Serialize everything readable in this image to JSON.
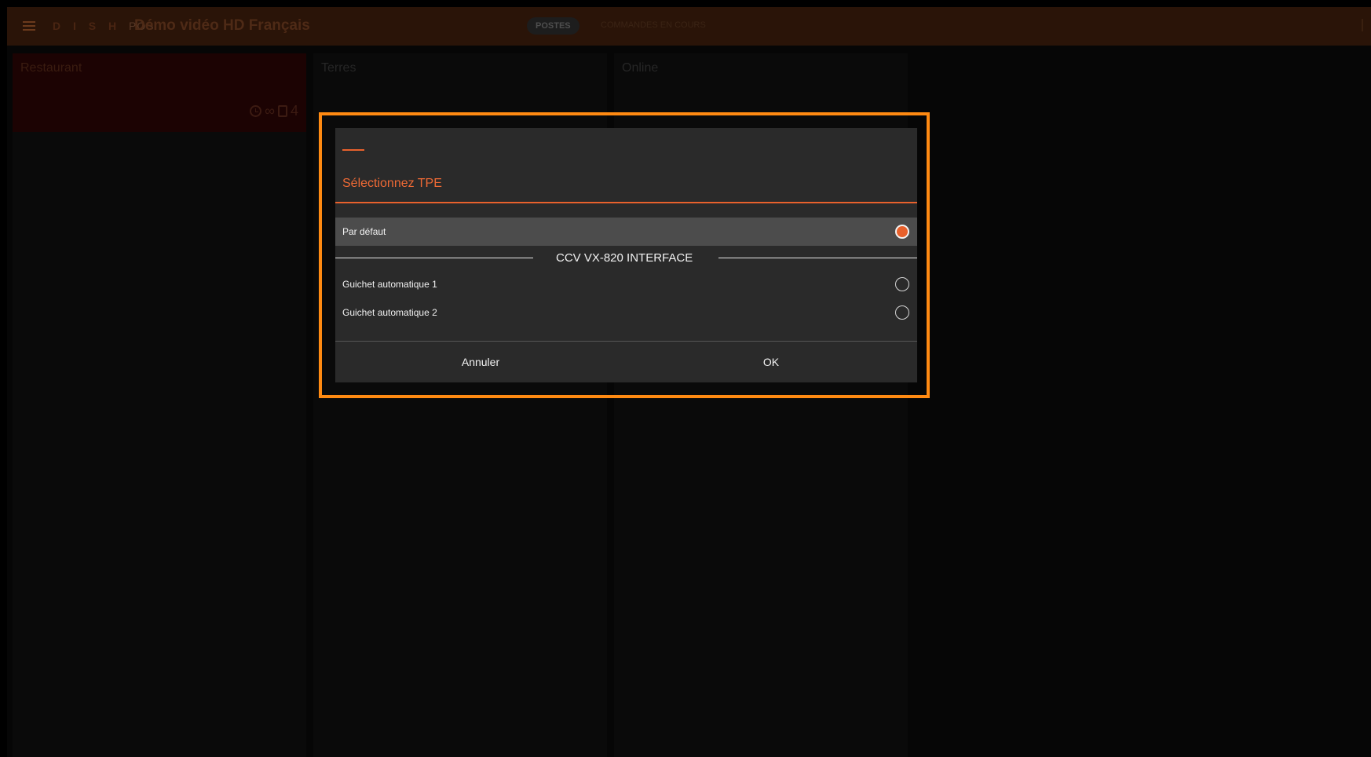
{
  "header": {
    "logo_dish": "D I S H",
    "logo_pos": "POS",
    "title": "Démo vidéo HD Français",
    "tabs": [
      {
        "label": "POSTES"
      },
      {
        "label": "COMMANDES EN COURS"
      }
    ]
  },
  "panels": [
    {
      "title": "Restaurant",
      "stats": {
        "infinity": "∞",
        "count": "4"
      }
    },
    {
      "title": "Terres"
    },
    {
      "title": "Online"
    }
  ],
  "dialog": {
    "title": "Sélectionnez TPE",
    "default_option": {
      "label": "Par défaut",
      "selected": true
    },
    "group": {
      "label": "CCV VX-820 INTERFACE",
      "options": [
        {
          "label": "Guichet automatique 1",
          "selected": false
        },
        {
          "label": "Guichet automatique 2",
          "selected": false
        }
      ]
    },
    "buttons": {
      "cancel": "Annuler",
      "ok": "OK"
    }
  },
  "colors": {
    "accent": "#e8612c",
    "highlight_frame": "#ff8a12",
    "dialog_bg": "#2a2a2a",
    "selected_row_bg": "#4c4c4c"
  }
}
